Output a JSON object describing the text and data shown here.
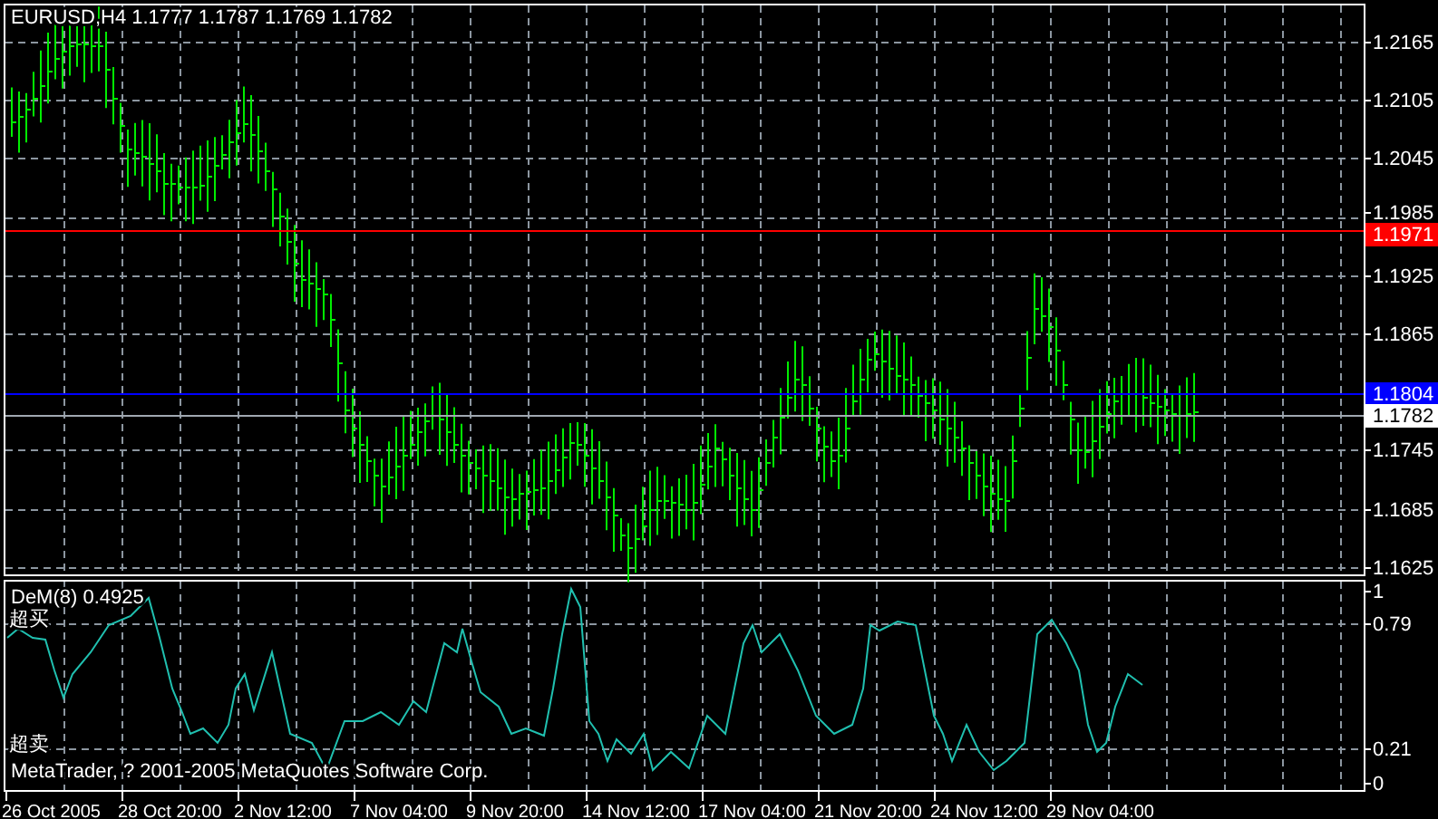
{
  "header": {
    "symbol": "EURUSD,H4",
    "ohlc": [
      "1.1777",
      "1.1787",
      "1.1769",
      "1.1782"
    ]
  },
  "price_axis": {
    "ticks": [
      "1.2165",
      "1.2105",
      "1.2045",
      "1.1985",
      "1.1925",
      "1.1865",
      "1.1745",
      "1.1685",
      "1.1625"
    ],
    "markers": [
      {
        "label": "1.1971",
        "color": "#ff0000"
      },
      {
        "label": "1.1804",
        "color": "#0000ff"
      },
      {
        "label": "1.1782",
        "color": "#ffffff"
      }
    ]
  },
  "indicator": {
    "title": "DeM(8) 0.4925",
    "overbought_label": "超买",
    "oversold_label": "超卖",
    "axis_ticks": [
      "1",
      "0.79",
      "0.21",
      "0"
    ]
  },
  "copyright": "MetaTrader, ? 2001-2005 MetaQuotes Software Corp.",
  "time_axis": [
    "26 Oct 2005",
    "28 Oct 20:00",
    "2 Nov 12:00",
    "7 Nov 04:00",
    "9 Nov 20:00",
    "14 Nov 12:00",
    "17 Nov 04:00",
    "21 Nov 20:00",
    "24 Nov 12:00",
    "29 Nov 04:00"
  ]
}
